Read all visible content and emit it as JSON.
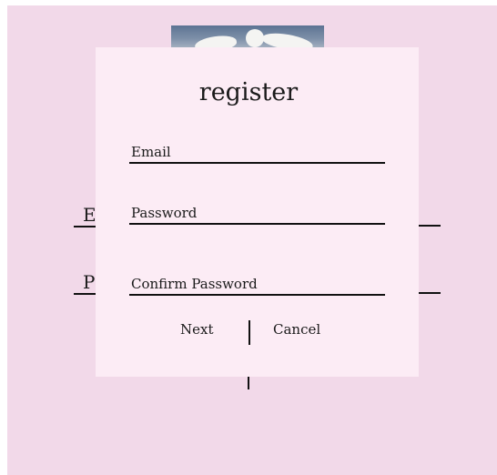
{
  "background": {
    "photo": "swan-photo",
    "partial_labels": [
      "E",
      "P"
    ],
    "colors": {
      "page": "#f2d9e9",
      "modal": "#fcecf5",
      "ink": "#111111"
    }
  },
  "register": {
    "title": "register",
    "fields": {
      "email": {
        "label": "Email"
      },
      "password": {
        "label": "Password"
      },
      "confirm_password": {
        "label": "Confirm Password"
      }
    },
    "buttons": {
      "next": "Next",
      "cancel": "Cancel"
    }
  }
}
